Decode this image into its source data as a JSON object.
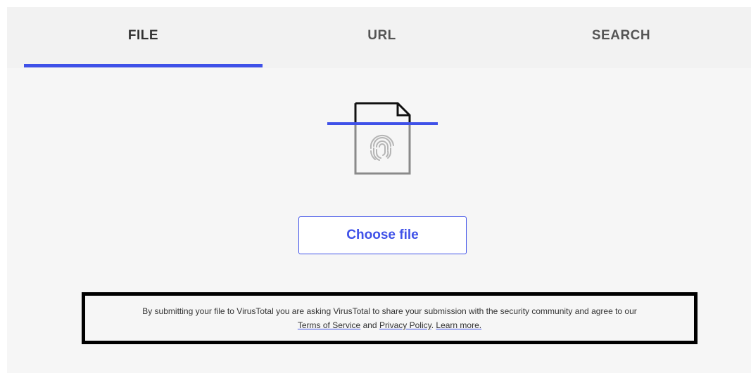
{
  "tabs": {
    "file": "FILE",
    "url": "URL",
    "search": "SEARCH"
  },
  "active_tab": "file",
  "upload": {
    "choose_file_label": "Choose file"
  },
  "notice": {
    "text_line1": "By submitting your file to VirusTotal you are asking VirusTotal to share your submission with the security community and agree to our",
    "terms_link": "Terms of Service",
    "and_text": " and ",
    "privacy_link": "Privacy Policy",
    "period": ". ",
    "learn_more_link": "Learn more."
  },
  "icons": {
    "file_icon": "fingerprint-file-icon"
  },
  "colors": {
    "accent": "#3f51e8",
    "tab_background": "#f2f2f2",
    "page_background": "#f6f6f6",
    "highlight_border": "#000000"
  }
}
